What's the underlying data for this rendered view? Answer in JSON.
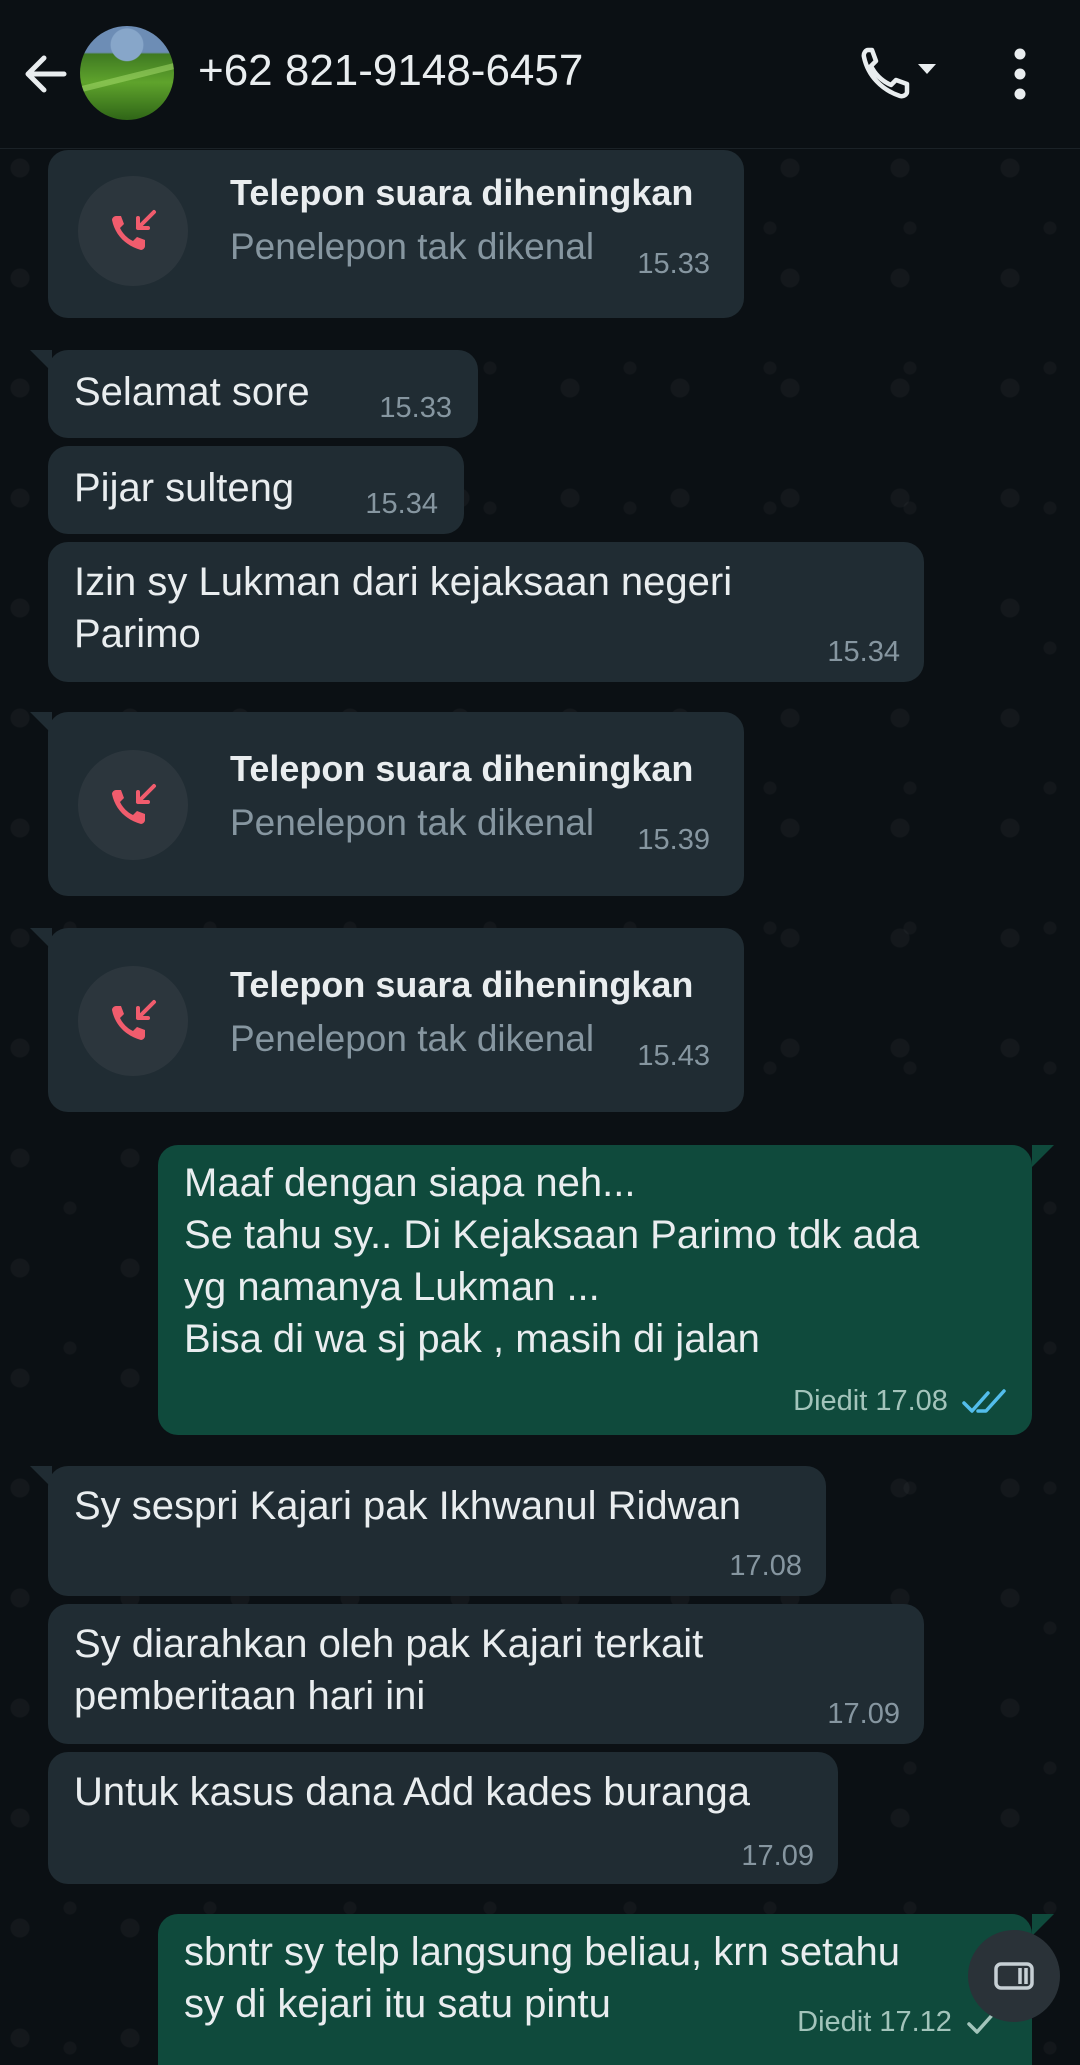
{
  "header": {
    "contact": "+62 821-9148-6457",
    "back_icon": "arrow-left-icon",
    "call_icon": "phone-dropdown-icon",
    "menu_icon": "more-vertical-icon"
  },
  "colors": {
    "incoming_bubble": "#202c33",
    "outgoing_bubble": "#0f4a3c",
    "missed_call_red": "#f15c6d",
    "read_ticks_blue": "#53bdeb"
  },
  "messages": [
    {
      "kind": "call",
      "title": "Telepon suara diheningkan",
      "subtitle": "Penelepon tak dikenal",
      "time": "15.33"
    },
    {
      "kind": "in",
      "text": "Selamat sore",
      "time": "15.33"
    },
    {
      "kind": "in",
      "text": "Pijar sulteng",
      "time": "15.34"
    },
    {
      "kind": "in",
      "text": "Izin sy Lukman dari kejaksaan negeri\nParimo",
      "time": "15.34"
    },
    {
      "kind": "call",
      "title": "Telepon suara diheningkan",
      "subtitle": "Penelepon tak dikenal",
      "time": "15.39"
    },
    {
      "kind": "call",
      "title": "Telepon suara diheningkan",
      "subtitle": "Penelepon tak dikenal",
      "time": "15.43"
    },
    {
      "kind": "out",
      "text": "Maaf dengan  siapa neh...\nSe tahu sy.. Di Kejaksaan Parimo tdk ada\nyg namanya Lukman ...\nBisa di wa sj pak , masih di jalan",
      "time": "Diedit 17.08",
      "status": "read"
    },
    {
      "kind": "in",
      "text": "Sy sespri Kajari pak Ikhwanul Ridwan",
      "time": "17.08"
    },
    {
      "kind": "in",
      "text": "Sy diarahkan oleh pak Kajari terkait\npemberitaan  hari ini",
      "time": "17.09"
    },
    {
      "kind": "in",
      "text": "Untuk kasus dana Add kades buranga",
      "time": "17.09"
    },
    {
      "kind": "out",
      "text": "sbntr sy telp langsung beliau, krn setahu\nsy di kejari itu satu pintu",
      "time": "Diedit 17.12",
      "status": "sent"
    }
  ],
  "floating_button": {
    "icon": "picture-in-picture-icon"
  }
}
